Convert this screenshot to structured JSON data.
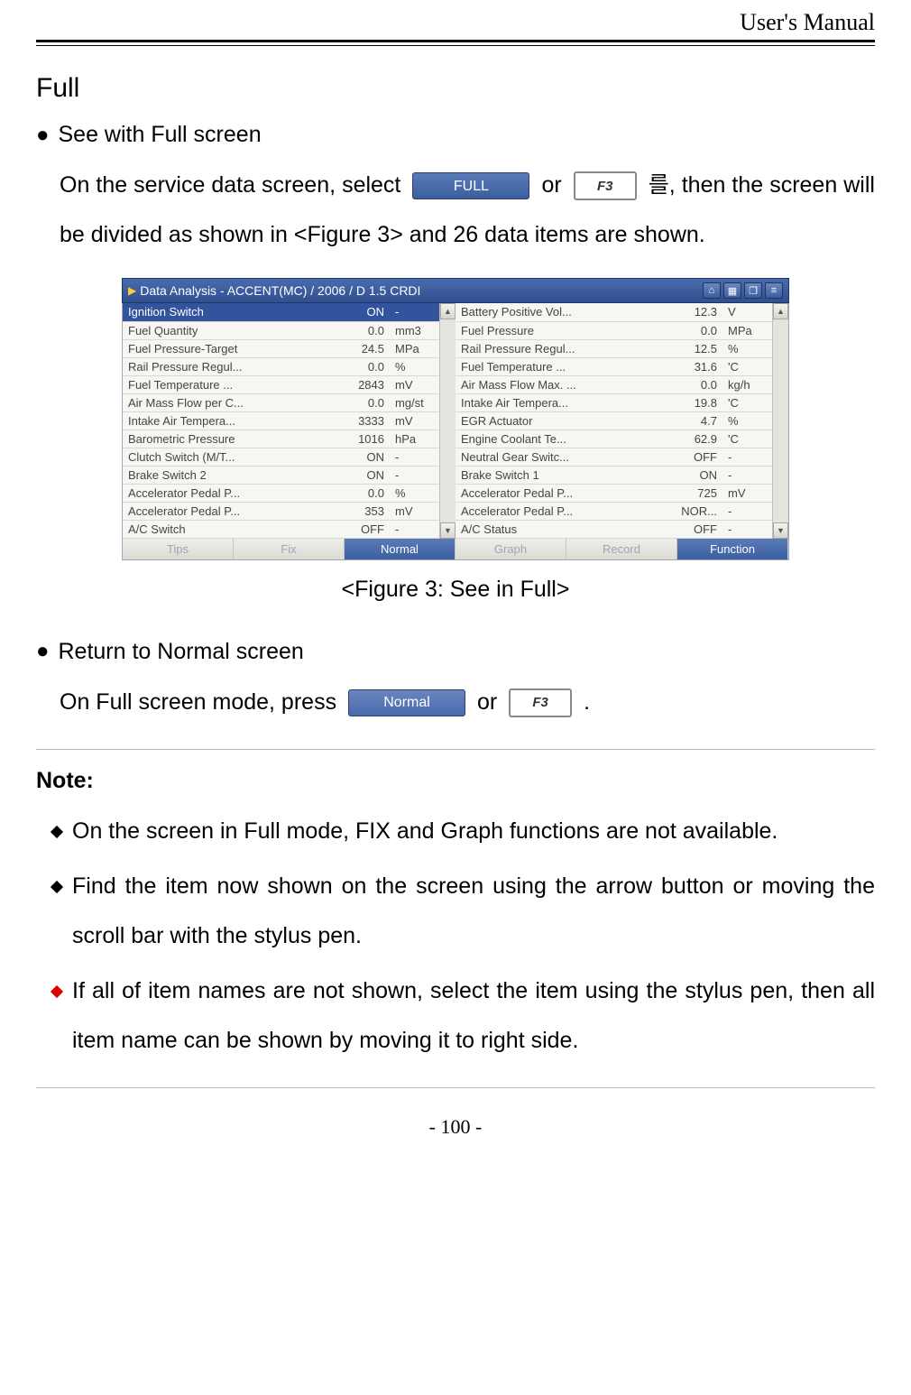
{
  "header": {
    "title": "User's Manual"
  },
  "section": {
    "title": "Full"
  },
  "bullet1": {
    "heading": "See with Full screen",
    "para_pre": "On the service data screen, select ",
    "full_btn": "FULL",
    "para_mid": " or ",
    "f3_btn": "F3",
    "para_post": " 를, then the screen will be divided as shown in <Figure 3> and 26 data items are shown."
  },
  "figure": {
    "titlebar": "Data Analysis - ACCENT(MC) / 2006 / D 1.5 CRDI",
    "caption": "<Figure 3: See in Full>",
    "left": [
      {
        "name": "Ignition Switch",
        "val": "ON",
        "unit": "-"
      },
      {
        "name": "Fuel Quantity",
        "val": "0.0",
        "unit": "mm3"
      },
      {
        "name": "Fuel Pressure-Target",
        "val": "24.5",
        "unit": "MPa"
      },
      {
        "name": "Rail Pressure Regul...",
        "val": "0.0",
        "unit": "%"
      },
      {
        "name": "Fuel Temperature ...",
        "val": "2843",
        "unit": "mV"
      },
      {
        "name": "Air Mass Flow per C...",
        "val": "0.0",
        "unit": "mg/st"
      },
      {
        "name": "Intake Air Tempera...",
        "val": "3333",
        "unit": "mV"
      },
      {
        "name": "Barometric Pressure",
        "val": "1016",
        "unit": "hPa"
      },
      {
        "name": "Clutch Switch (M/T...",
        "val": "ON",
        "unit": "-"
      },
      {
        "name": "Brake Switch 2",
        "val": "ON",
        "unit": "-"
      },
      {
        "name": "Accelerator Pedal P...",
        "val": "0.0",
        "unit": "%"
      },
      {
        "name": "Accelerator Pedal P...",
        "val": "353",
        "unit": "mV"
      },
      {
        "name": "A/C Switch",
        "val": "OFF",
        "unit": "-"
      }
    ],
    "right": [
      {
        "name": "Battery Positive Vol...",
        "val": "12.3",
        "unit": "V"
      },
      {
        "name": "Fuel Pressure",
        "val": "0.0",
        "unit": "MPa"
      },
      {
        "name": "Rail Pressure Regul...",
        "val": "12.5",
        "unit": "%"
      },
      {
        "name": "Fuel Temperature ...",
        "val": "31.6",
        "unit": "'C"
      },
      {
        "name": "Air Mass Flow Max. ...",
        "val": "0.0",
        "unit": "kg/h"
      },
      {
        "name": "Intake Air Tempera...",
        "val": "19.8",
        "unit": "'C"
      },
      {
        "name": "EGR Actuator",
        "val": "4.7",
        "unit": "%"
      },
      {
        "name": "Engine Coolant Te...",
        "val": "62.9",
        "unit": "'C"
      },
      {
        "name": "Neutral Gear Switc...",
        "val": "OFF",
        "unit": "-"
      },
      {
        "name": "Brake Switch 1",
        "val": "ON",
        "unit": "-"
      },
      {
        "name": "Accelerator Pedal P...",
        "val": "725",
        "unit": "mV"
      },
      {
        "name": "Accelerator Pedal P...",
        "val": "NOR...",
        "unit": "-"
      },
      {
        "name": "A/C Status",
        "val": "OFF",
        "unit": "-"
      }
    ],
    "footer": [
      "Tips",
      "Fix",
      "Normal",
      "Graph",
      "Record",
      "Function"
    ]
  },
  "bullet2": {
    "heading": "Return to Normal screen",
    "para_pre": "On Full screen mode, press ",
    "normal_btn": "Normal",
    "para_mid": " or ",
    "f3_btn": "F3",
    "para_post": "."
  },
  "note": {
    "title": "Note:",
    "items": [
      {
        "color": "black",
        "text": "On the screen in Full mode, FIX and Graph functions are not available."
      },
      {
        "color": "black",
        "text": "Find the item now shown on the screen using the arrow button or moving the scroll bar with the stylus pen."
      },
      {
        "color": "red",
        "text": "If all of item names are not shown, select the item using the stylus pen, then all item name can be shown by moving it to right side."
      }
    ]
  },
  "page_number": "- 100 -"
}
